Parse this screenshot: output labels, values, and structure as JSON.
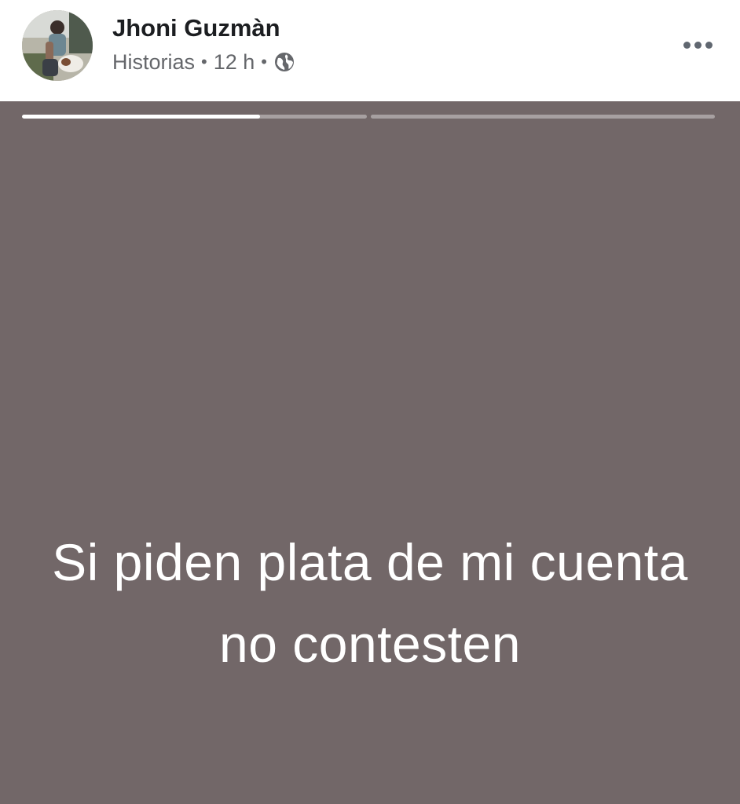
{
  "header": {
    "author_name": "Jhoni Guzmàn",
    "section": "Historias",
    "time": "12 h",
    "separator": "•",
    "privacy_icon": "globe-icon",
    "more_icon": "more-options-icon"
  },
  "story": {
    "text": "Si piden plata de mi cuenta no contesten",
    "background_color": "#726768",
    "progress_segments": [
      {
        "progress": 0.69
      },
      {
        "progress": 0.0
      }
    ]
  }
}
